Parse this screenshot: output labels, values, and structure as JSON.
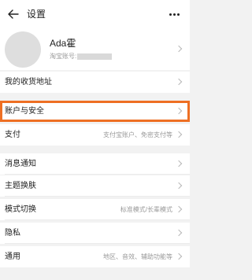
{
  "header": {
    "title": "设置"
  },
  "profile": {
    "name": "Ada霍",
    "account_label": "淘宝账号:"
  },
  "rows": [
    {
      "label": "我的收货地址",
      "value": ""
    },
    {
      "label": "账户与安全",
      "value": ""
    },
    {
      "label": "支付",
      "value": "支付宝账户、免密支付等"
    },
    {
      "label": "消息通知",
      "value": ""
    },
    {
      "label": "主题换肤",
      "value": ""
    },
    {
      "label": "模式切换",
      "value": "标准模式/长辈模式"
    },
    {
      "label": "隐私",
      "value": ""
    },
    {
      "label": "通用",
      "value": "地区、音效、辅助功能等"
    }
  ],
  "icons": {
    "back": "back-arrow-icon",
    "more": "more-dots-icon",
    "chevron": "chevron-right-icon"
  },
  "colors": {
    "accent": "#ee6f23",
    "background": "#f2f2f2"
  }
}
